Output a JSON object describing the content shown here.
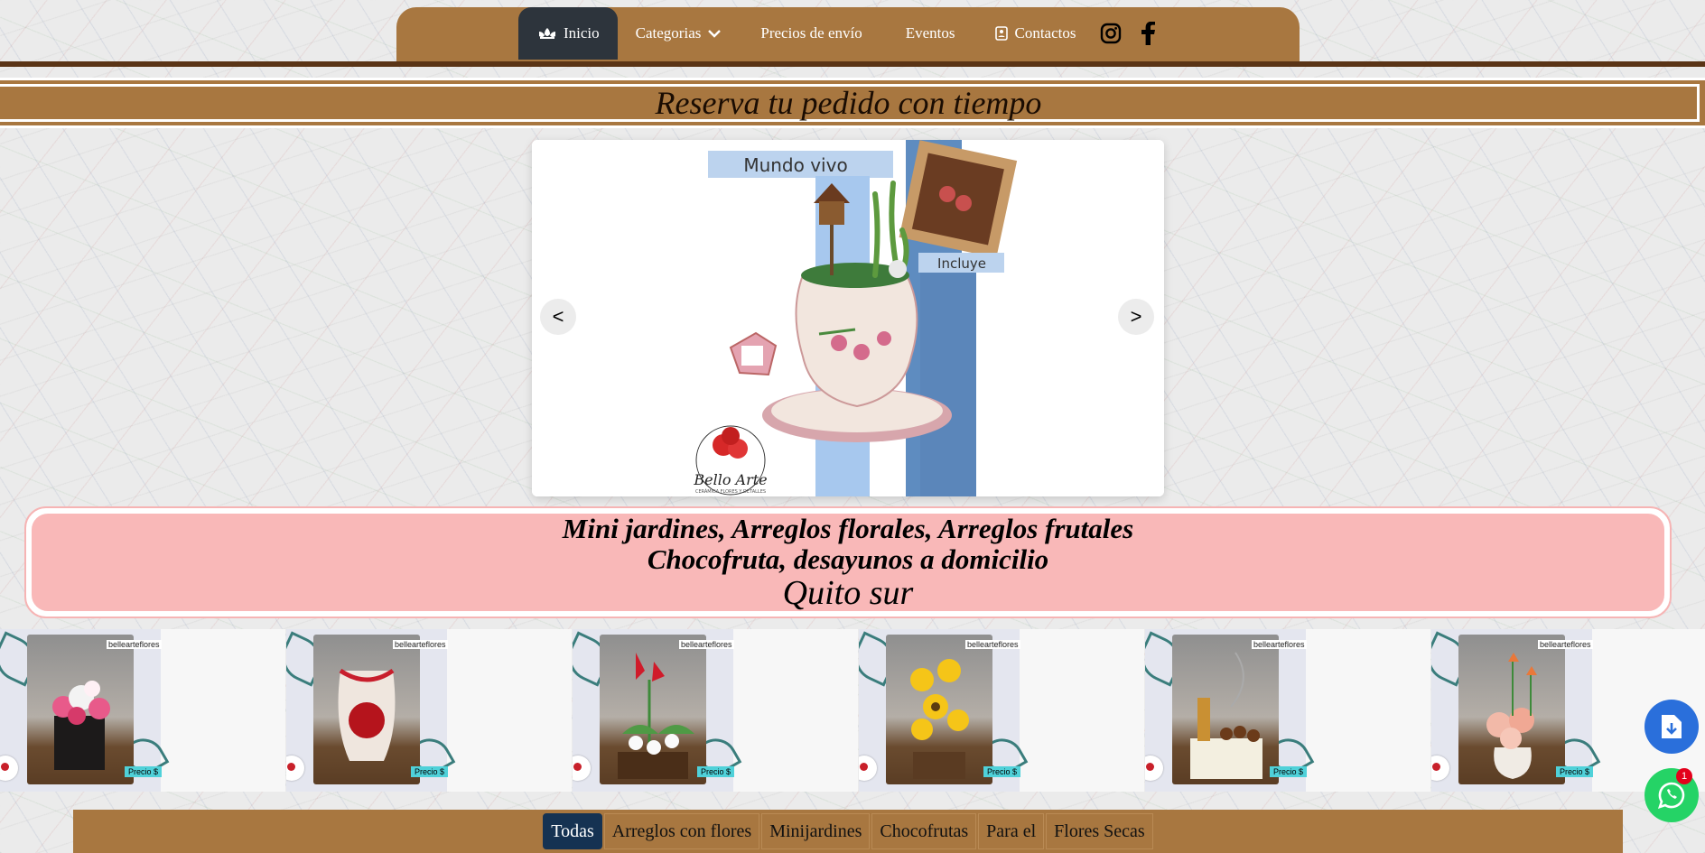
{
  "nav": {
    "items": [
      {
        "label": "Inicio",
        "icon": "lotus-icon",
        "active": true
      },
      {
        "label": "Categorias",
        "icon": "chevron-down-icon"
      },
      {
        "label": "Precios de envío"
      },
      {
        "label": "Eventos"
      },
      {
        "label": "Contactos",
        "icon": "address-book-icon"
      }
    ],
    "social": [
      "instagram-icon",
      "facebook-icon"
    ]
  },
  "banner": {
    "text": "Reserva tu pedido con tiempo"
  },
  "carousel": {
    "prev_label": "<",
    "next_label": ">",
    "slide": {
      "heading": "Mundo vivo",
      "side_label": "Incluye",
      "logo_text": "Bello Arte",
      "logo_subtext": "CERÁMICA FLORES Y DETALLES"
    }
  },
  "promo": {
    "line1": "Mini jardines, Arreglos florales, Arreglos frutales",
    "line2": "Chocofruta, desayunos a domicilio",
    "line3": "Quito sur"
  },
  "products": [
    {
      "tag": "bellearteflores",
      "price": "Precio $"
    },
    {
      "tag": "bellearteflores",
      "price": "Precio $"
    },
    {
      "tag": "bellearteflores",
      "price": "Precio $"
    },
    {
      "tag": "bellearteflores",
      "price": "Precio $"
    },
    {
      "tag": "bellearteflores",
      "price": "Precio $"
    },
    {
      "tag": "bellearteflores",
      "price": "Precio $"
    }
  ],
  "categories": [
    {
      "label": "Todas",
      "active": true
    },
    {
      "label": "Arreglos con flores"
    },
    {
      "label": "Minijardines"
    },
    {
      "label": "Chocofrutas"
    },
    {
      "label": "Para el"
    },
    {
      "label": "Flores Secas"
    }
  ],
  "floating": {
    "download_icon": "download-file-icon",
    "whatsapp_icon": "whatsapp-icon",
    "whatsapp_badge": "1"
  },
  "colors": {
    "nav_brown": "#a87740",
    "nav_active": "#2d343c",
    "dark_stripe": "#5a3416",
    "promo_pink": "#f9b8b8",
    "cat_active": "#153252"
  }
}
